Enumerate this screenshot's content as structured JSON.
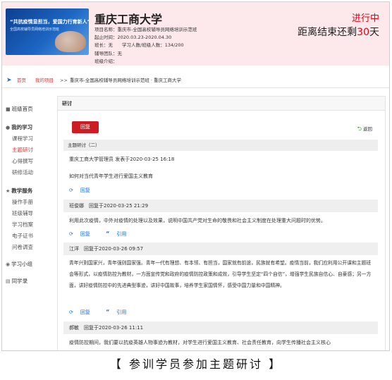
{
  "header": {
    "banner_line1": "“共抗疫情显担当，爱国力行育新人”",
    "banner_line2": "全国高校辅导员网络培训示范班",
    "title": "重庆工商大学",
    "project_name": "项目名称：重庆市-全国高校辅导员网络培训示范班",
    "period": "起止时间：2020.03.23-2020.04.30",
    "class_info": "班长：无　　学习人数/班级人数：134/200",
    "team": "辅导团队：无",
    "group": "班级介绍：",
    "status": "进行中",
    "countdown_prefix": "距离结束还剩",
    "countdown_days": "30",
    "countdown_suffix": "天"
  },
  "breadcrumb": {
    "home": "首页",
    "project": "我的项目",
    "separator": ">>",
    "path": "重庆市-全国高校辅导员网络培训示范班 · 重庆工商大学"
  },
  "sidebar": {
    "home": "班级首页",
    "my_study": "我的学习",
    "course": "课程学习",
    "topic": "主题研讨",
    "notes": "心得撰写",
    "activity": "研修活动",
    "service": "教学服务",
    "manual": "操作手册",
    "tutor": "班级辅导",
    "archive": "学习档案",
    "cert": "电子证书",
    "survey": "问卷调查",
    "group": "学习小组",
    "classmates": "同学录"
  },
  "main": {
    "panel_title": "研讨",
    "reply_button": "回复",
    "back": "返回",
    "topic_label": "主题研讨（二）",
    "topic_author": "重庆工商大学管理员 发表于2020-03-25 16:18",
    "topic_question": "如何对当代青年学生进行爱国主义教育",
    "reply_link": "回复",
    "quote_link": "引用",
    "posts": [
      {
        "author_line": "班俊娜　回复于2020-03-25 21:29",
        "content": "利用此次疫情，中外对疫情的处理以及效果，说明中国共产党对生命的敬畏和社会主义制度在处理重大问题时的优势。"
      },
      {
        "author_line": "江洋　回复于2020-03-26 09:57",
        "content": "青年兴则国家兴，青年强则国家强。青年一代有理想、有本领、有担当，国家就有前途，民族就有希望。疫情当前，我们应利用公开课和主题班会等形式，以疫情防控为教材，一方面宣传党和政府的疫情防控政策和成效，引导学生坚定“四个自信”，增强学生民族自信心、自豪感；另一方面，讲好疫情防控中的先进典型事迹，讲好中国故事，培养学生家国情怀，感受中国力量和中国精神。"
      },
      {
        "author_line": "郝敏　回复于2020-03-26 11:11",
        "content": "疫情防控期间，我们要以抗疫英雄人物事迹为教材，对学生进行爱国主义教育、社会责任教育，向学生传播社会主义核心"
      }
    ]
  },
  "caption": "【 参训学员参加主题研讨 】",
  "colors": {
    "accent": "#e60012",
    "link": "#1c6fd1",
    "header_bg": "#fde9eb",
    "button": "#cc1c24"
  }
}
